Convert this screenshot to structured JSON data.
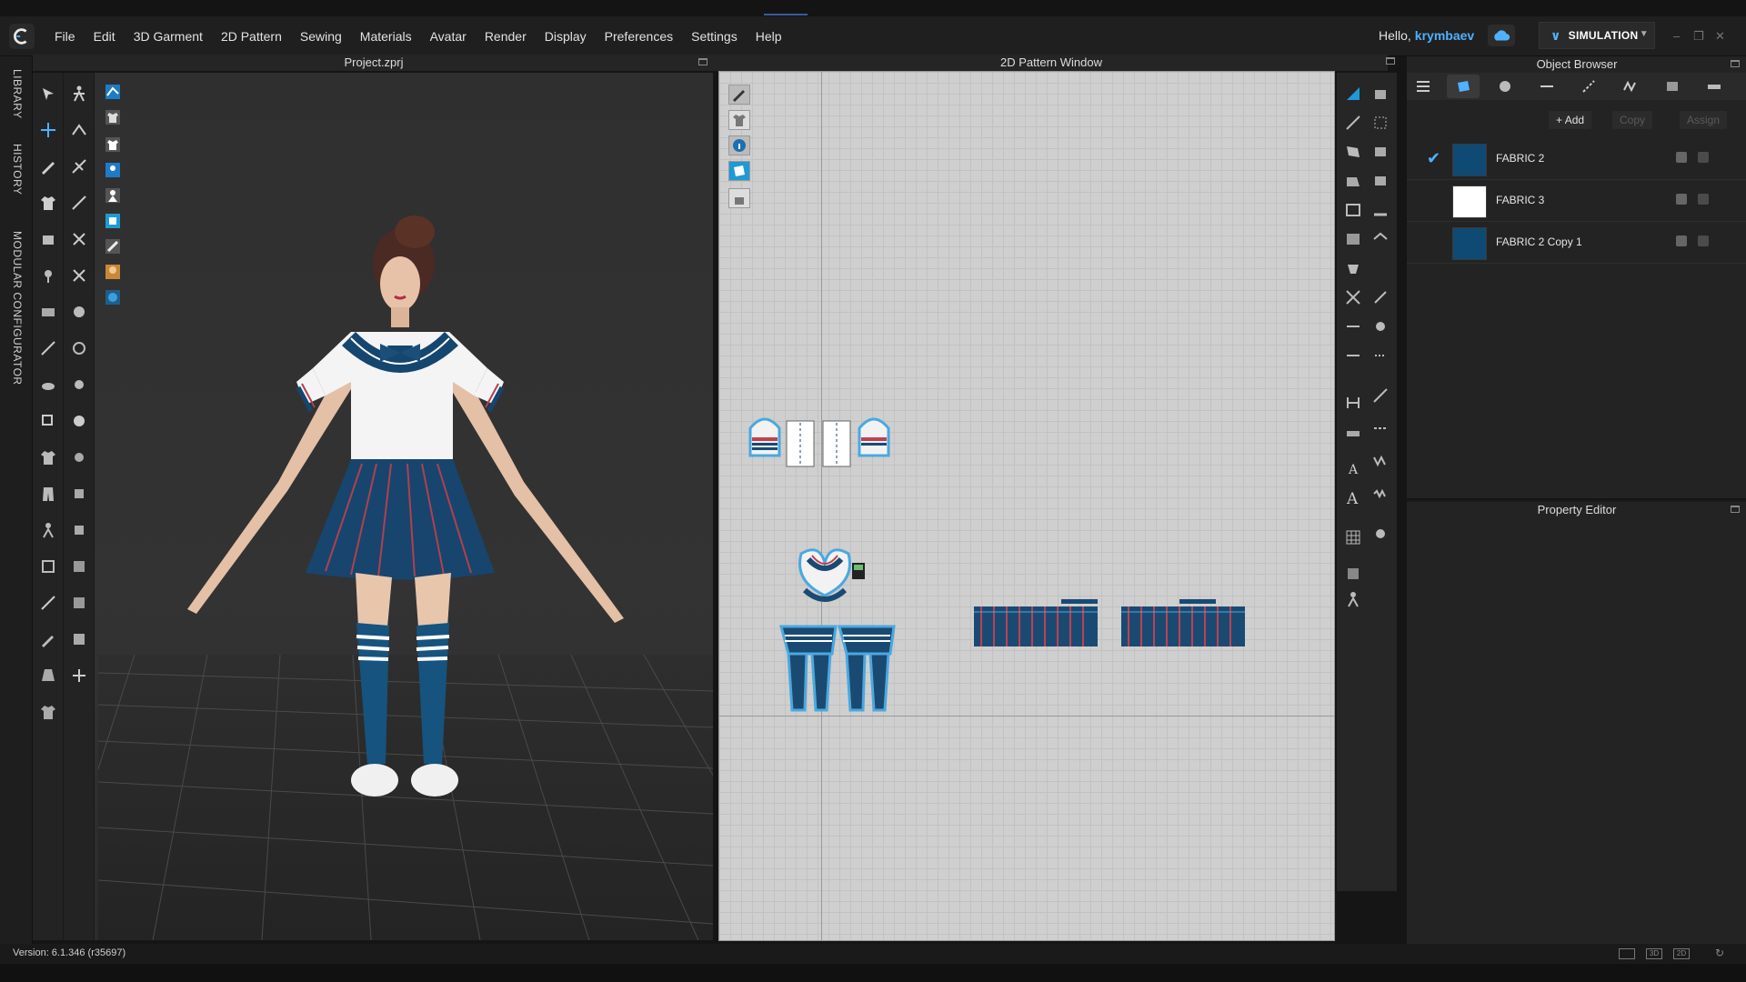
{
  "app": {
    "menu": [
      "File",
      "Edit",
      "3D Garment",
      "2D Pattern",
      "Sewing",
      "Materials",
      "Avatar",
      "Render",
      "Display",
      "Preferences",
      "Settings",
      "Help"
    ],
    "greeting": "Hello,",
    "username": "krymbaev",
    "mode_label": "SIMULATION",
    "accent_color": "#4fb1ff"
  },
  "left_rail": {
    "labels": [
      "LIBRARY",
      "HISTORY",
      "MODULAR CONFIGURATOR"
    ]
  },
  "viewport3d": {
    "title": "Project.zprj"
  },
  "pattern_window": {
    "title": "2D Pattern Window"
  },
  "object_browser": {
    "title": "Object Browser",
    "actions": {
      "add": "Add",
      "copy": "Copy",
      "assign": "Assign"
    },
    "fabrics": [
      {
        "name": "FABRIC 2",
        "color": "#0e4a73",
        "selected": true
      },
      {
        "name": "FABRIC 3",
        "color": "#ffffff",
        "selected": false
      },
      {
        "name": "FABRIC 2 Copy 1",
        "color": "#0e4a73",
        "selected": false
      }
    ]
  },
  "property_editor": {
    "title": "Property Editor"
  },
  "status": {
    "version": "Version: 6.1.346 (r35697)",
    "view_icons": [
      "3D",
      "2D"
    ]
  }
}
